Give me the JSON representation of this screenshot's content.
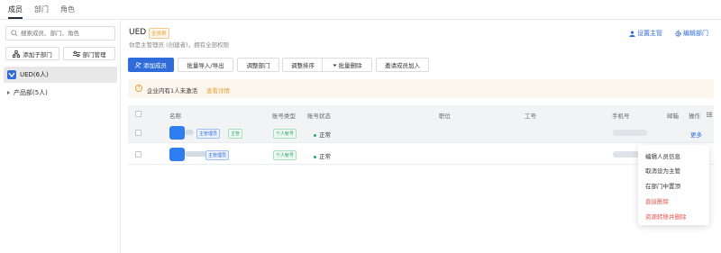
{
  "topnav": {
    "tabs": [
      "成员",
      "部门",
      "角色"
    ]
  },
  "sidebar": {
    "search_placeholder": "搜索成员、部门、角色",
    "add_sub_dept": "添加子部门",
    "dept_manage": "部门管理",
    "tree": [
      {
        "label": "UED(6人)"
      },
      {
        "label": "产品部(5人)"
      }
    ]
  },
  "header": {
    "title": "UED",
    "badge": "全员群",
    "subtitle": "你是主管理员 (创建者)，拥有全部权限",
    "set_supervisor": "设置主管",
    "edit_dept": "编辑部门"
  },
  "toolbar": {
    "add_member": "添加成员",
    "import_export": "批量导入/导出",
    "adjust_dept": "调整部门",
    "adjust_order": "调整排序",
    "batch_delete": "批量删除",
    "invite": "邀请成员加入"
  },
  "notice": {
    "text": "企业内有1人未激活",
    "link": "查看详情"
  },
  "table": {
    "columns": [
      "名称",
      "账号类型",
      "账号状态",
      "职位",
      "工号",
      "手机号",
      "邮箱",
      "操作"
    ],
    "rows": [
      {
        "tags": [
          "主管理员",
          "主管"
        ],
        "account_type": "个人帐号",
        "status": "正常",
        "action": "更多"
      },
      {
        "tags": [
          "主管理员"
        ],
        "account_type": "个人帐号",
        "status": "正常"
      }
    ]
  },
  "context_menu": {
    "items": [
      "编辑人员信息",
      "取消设为主管",
      "在部门中置顶",
      "直接删除",
      "资源转移并删除"
    ]
  },
  "colors": {
    "primary": "#2f6bd9",
    "warning": "#e6a23c",
    "danger": "#e2574c",
    "success": "#2fa366"
  }
}
